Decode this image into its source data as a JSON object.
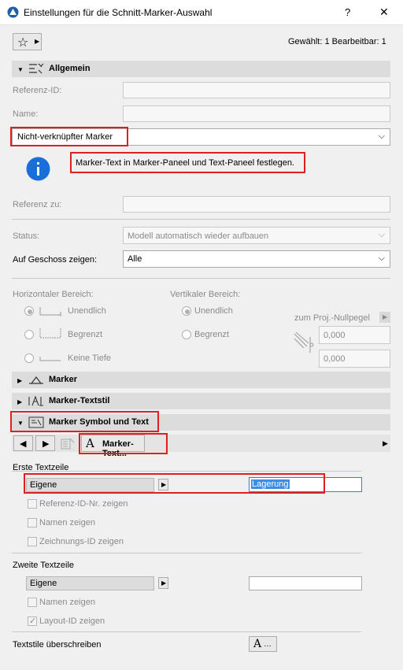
{
  "window": {
    "title": "Einstellungen für die Schnitt-Marker-Auswahl",
    "help": "?",
    "close": "✕"
  },
  "header": {
    "selection_info": "Gewählt: 1 Bearbeitbar: 1"
  },
  "general": {
    "title": "Allgemein",
    "ref_id_label": "Referenz-ID:",
    "name_label": "Name:",
    "marker_type": "Nicht-verknüpfter Marker",
    "info_text": "Marker-Text in Marker-Paneel und Text-Paneel festlegen.",
    "ref_to_label": "Referenz zu:",
    "status_label": "Status:",
    "status_value": "Modell automatisch wieder aufbauen",
    "story_label": "Auf Geschoss zeigen:",
    "story_value": "Alle",
    "horizontal_label": "Horizontaler Bereich:",
    "vertical_label": "Vertikaler Bereich:",
    "h_infinite": "Unendlich",
    "h_limited": "Begrenzt",
    "h_no_depth": "Keine Tiefe",
    "v_infinite": "Unendlich",
    "v_limited": "Begrenzt",
    "zero_level": "zum Proj.-Nullpegel",
    "val1": "0,000",
    "val2": "0,000"
  },
  "sections": {
    "marker": "Marker",
    "marker_textstyle": "Marker-Textstil",
    "marker_symbol_text": "Marker Symbol und Text"
  },
  "toolbar": {
    "marker_text_btn": "Marker-Text..."
  },
  "first_line": {
    "title": "Erste Textzeile",
    "source": "Eigene",
    "text_value": "Lagerung",
    "show_ref_id": "Referenz-ID-Nr. zeigen",
    "show_name": "Namen zeigen",
    "show_drawing_id": "Zeichnungs-ID zeigen"
  },
  "second_line": {
    "title": "Zweite Textzeile",
    "source": "Eigene",
    "text_value": "",
    "show_name": "Namen zeigen",
    "show_layout_id": "Layout-ID zeigen"
  },
  "override": {
    "label": "Textstile überschreiben"
  }
}
